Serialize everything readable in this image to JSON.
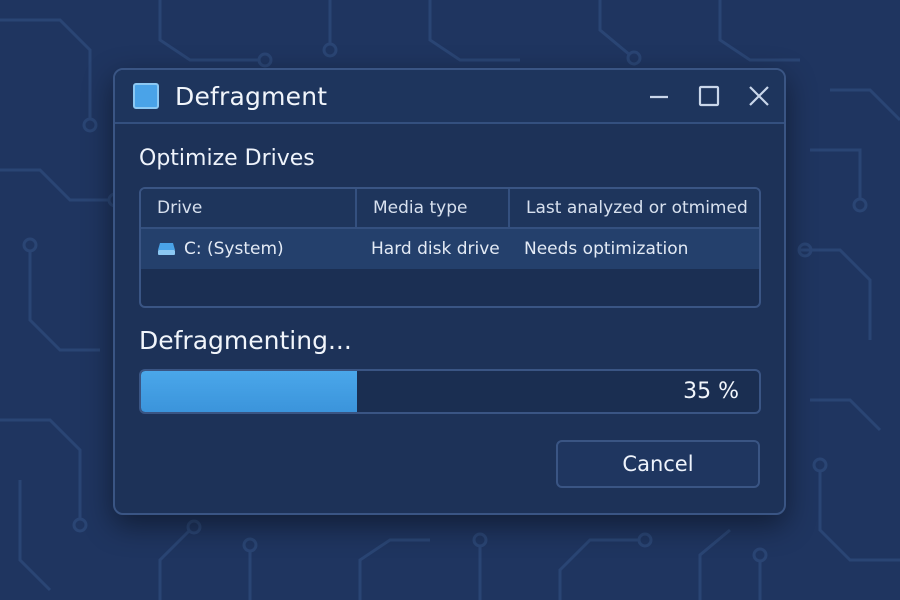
{
  "window": {
    "title": "Defragment",
    "icon": "app-square-icon",
    "controls": [
      "minimize-icon",
      "maximize-icon",
      "close-icon"
    ]
  },
  "main": {
    "section_title": "Optimize Drives",
    "table": {
      "columns": [
        "Drive",
        "Media type",
        "Last analyzed or otmimed"
      ],
      "rows": [
        {
          "drive": "C: (System)",
          "icon": "drive-icon",
          "media_type": "Hard disk drive",
          "status": "Needs optimization"
        }
      ]
    },
    "status_heading": "Defragmenting...",
    "progress": {
      "value": 0.35,
      "label": "35 %"
    },
    "cancel_label": "Cancel"
  },
  "colors": {
    "background": "#1f3560",
    "window": "#1d3258",
    "accent": "#4aa3e8",
    "progress_fill": "#3f9be0"
  }
}
